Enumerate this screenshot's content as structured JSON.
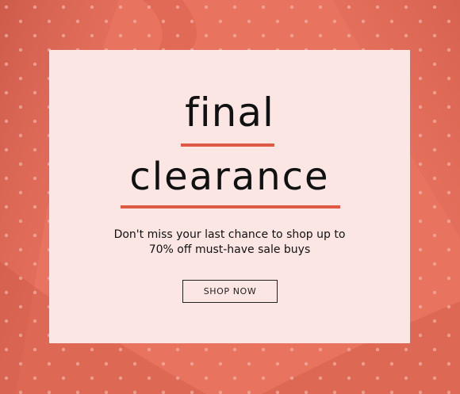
{
  "theme": {
    "background_color": "#e8735f",
    "card_color": "#fbe6e3",
    "accent_color": "#de5a44",
    "text_color": "#111111"
  },
  "banner": {
    "title_line1": "final",
    "title_line2": "clearance",
    "subtitle_line1": "Don't miss your last chance to shop up to",
    "subtitle_line2": "70% off must-have sale buys",
    "cta_label": "SHOP NOW"
  }
}
